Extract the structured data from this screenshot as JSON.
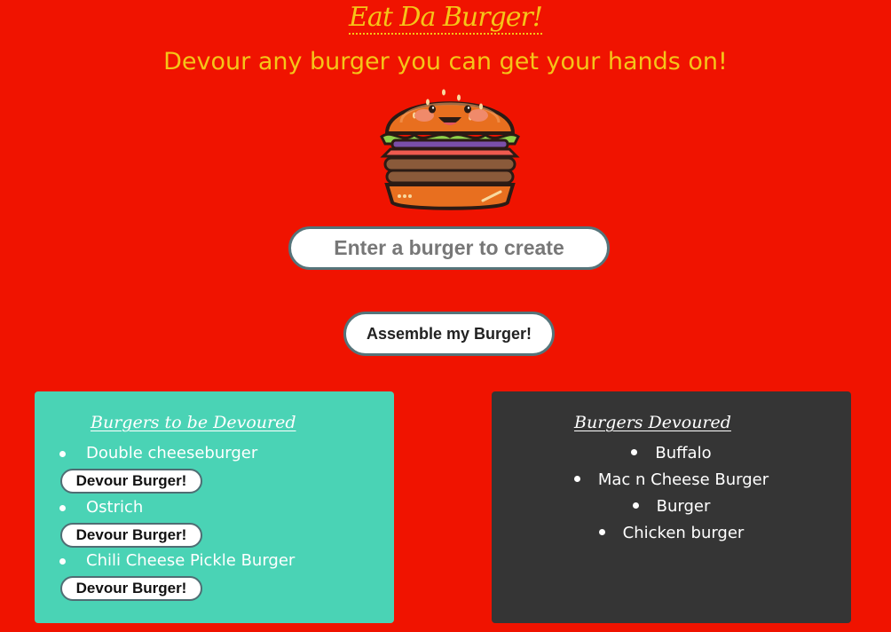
{
  "header": {
    "title": "Eat Da Burger!",
    "subtitle": "Devour any burger you can get your hands on!"
  },
  "mascot": {
    "icon": "burger-mascot-icon"
  },
  "form": {
    "input_placeholder": "Enter a burger to create",
    "input_value": "",
    "submit_label": "Assemble my Burger!"
  },
  "to_devour": {
    "title": "Burgers to be Devoured",
    "button_label": "Devour Burger!",
    "items": [
      {
        "name": "Double cheeseburger"
      },
      {
        "name": "Ostrich"
      },
      {
        "name": "Chili Cheese Pickle Burger"
      }
    ]
  },
  "devoured": {
    "title": "Burgers Devoured",
    "items": [
      "Buffalo",
      "Mac n Cheese Burger",
      "Burger",
      "Chicken burger"
    ]
  },
  "colors": {
    "background": "#f01300",
    "accent_text": "#f5c518",
    "to_devour_panel": "#4ad3b5",
    "devoured_panel": "#353535",
    "button_border": "#55747a"
  }
}
